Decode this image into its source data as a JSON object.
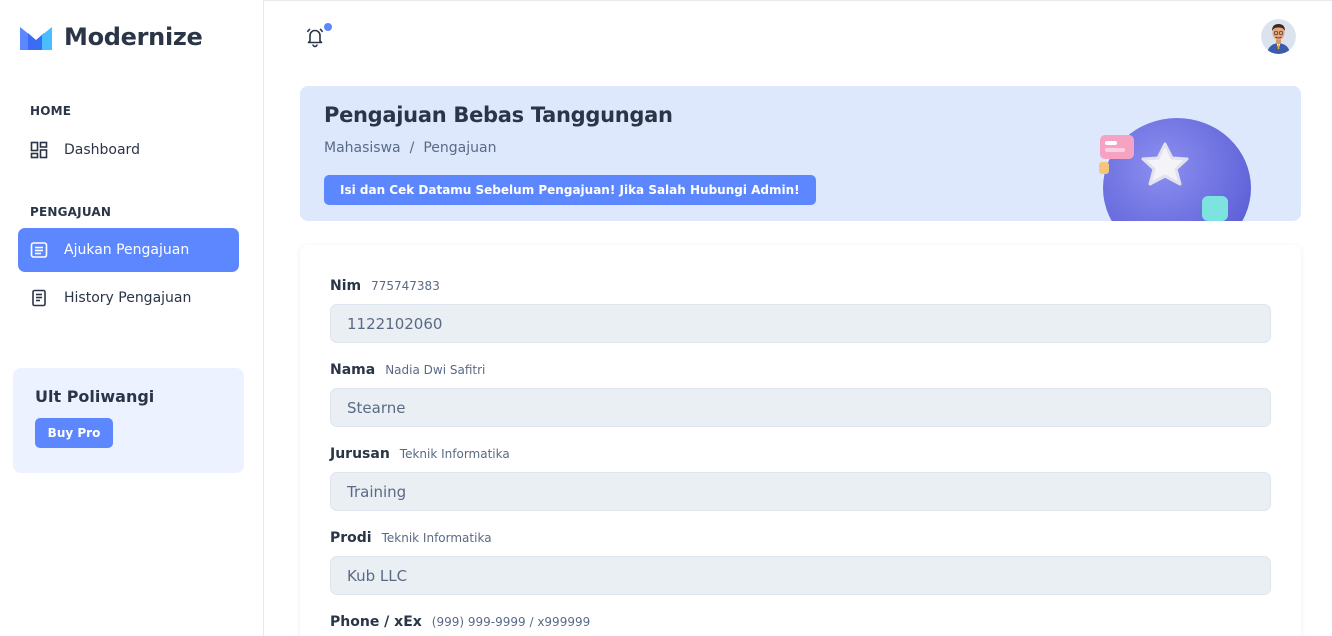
{
  "brand": {
    "name": "Modernize",
    "logo_icon": "modernize-logo-icon"
  },
  "sidebar": {
    "sections": [
      {
        "caption": "HOME",
        "items": [
          {
            "label": "Dashboard",
            "icon": "dashboard-icon",
            "active": false
          }
        ]
      },
      {
        "caption": "PENGAJUAN",
        "items": [
          {
            "label": "Ajukan Pengajuan",
            "icon": "form-icon",
            "active": true
          },
          {
            "label": "History Pengajuan",
            "icon": "history-icon",
            "active": false
          }
        ]
      }
    ],
    "promo": {
      "title": "Ult Poliwangi",
      "button": "Buy Pro"
    }
  },
  "header": {
    "bell_icon": "bell-icon",
    "avatar_icon": "user-avatar"
  },
  "banner": {
    "title": "Pengajuan Bebas Tanggungan",
    "breadcrumb": [
      "Mahasiswa",
      "Pengajuan"
    ],
    "breadcrumb_separator": "/",
    "alert_button": "Isi dan Cek Datamu Sebelum Pengajuan! Jika Salah Hubungi Admin!",
    "illustration_icon": "star-illustration"
  },
  "form": {
    "fields": [
      {
        "label": "Nim",
        "sublabel": "775747383",
        "value": "1122102060"
      },
      {
        "label": "Nama",
        "sublabel": "Nadia Dwi Safitri",
        "value": "Stearne"
      },
      {
        "label": "Jurusan",
        "sublabel": "Teknik Informatika",
        "value": "Training"
      },
      {
        "label": "Prodi",
        "sublabel": "Teknik Informatika",
        "value": "Kub LLC"
      },
      {
        "label": "Phone / xEx",
        "sublabel": "(999) 999-9999 / x999999",
        "value": ""
      }
    ]
  },
  "colors": {
    "primary": "#5d87ff",
    "banner_bg": "#dde8fd",
    "input_bg": "#eaeff4",
    "text": "#2a3547",
    "muted": "#5a6a85"
  }
}
